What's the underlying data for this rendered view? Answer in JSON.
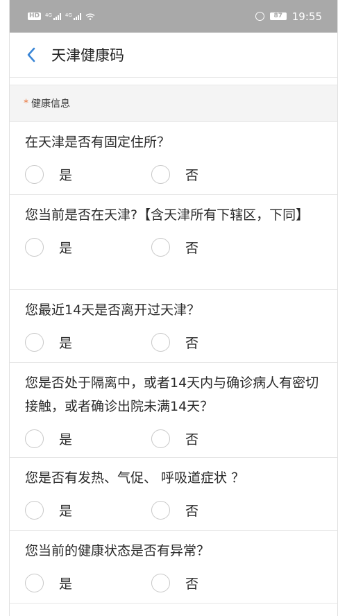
{
  "status_bar": {
    "hd_badge": "HD",
    "signal1_tag": "4G",
    "signal2_tag": "4G",
    "battery": "87",
    "time": "19:55"
  },
  "header": {
    "title": "天津健康码"
  },
  "section": {
    "required_mark": "*",
    "title": "健康信息"
  },
  "questions": [
    {
      "text": "在天津是否有固定住所？",
      "yes": "是",
      "no": "否"
    },
    {
      "text": "您当前是否在天津?【含天津所有下辖区，下同】",
      "yes": "是",
      "no": "否"
    },
    {
      "text": "您最近14天是否离开过天津？",
      "yes": "是",
      "no": "否"
    },
    {
      "text": "您是否处于隔离中，或者14天内与确诊病人有密切接触，或者确诊出院未满14天？",
      "yes": "是",
      "no": "否"
    },
    {
      "text": "您是否有发热、气促、 呼吸道症状 ？",
      "yes": "是",
      "no": "否"
    },
    {
      "text": "您当前的健康状态是否有异常？",
      "yes": "是",
      "no": "否"
    }
  ],
  "icons": {
    "back": "back-chevron-icon",
    "wifi": "wifi-icon",
    "alarm": "alarm-icon"
  },
  "colors": {
    "accent": "#3a86d6",
    "required": "#e8743b",
    "status_bar": "#a9a9a9"
  }
}
